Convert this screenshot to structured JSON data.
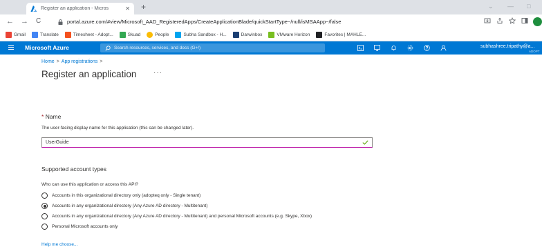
{
  "browser": {
    "tab_title": "Register an application - Micros",
    "tab_close": "✕",
    "new_tab": "+",
    "url": "portal.azure.com/#view/Microsoft_AAD_RegisteredApps/CreateApplicationBlade/quickStartType~/null/isMSAApp~/false",
    "nav": {
      "back": "←",
      "forward": "→",
      "reload": "C"
    },
    "window_controls": {
      "chevron": "⌄",
      "minimize": "—",
      "restore": "□"
    }
  },
  "bookmarks": [
    {
      "label": "Gmail",
      "color": "#ea4335"
    },
    {
      "label": "Translate",
      "color": "#4285f4"
    },
    {
      "label": "Timesheet - Adopt...",
      "color": "#f4511e"
    },
    {
      "label": "Skuad",
      "color": "#34a853"
    },
    {
      "label": "People",
      "color": "#fbbc04"
    },
    {
      "label": "Subha Sandbox - H...",
      "color": "#00a4ef"
    },
    {
      "label": "Darwinbox",
      "color": "#1a3e72"
    },
    {
      "label": "VMware Horizon",
      "color": "#78be20"
    },
    {
      "label": "Favorites | MAHLE...",
      "color": "#202124"
    }
  ],
  "azure": {
    "brand": "Microsoft Azure",
    "search_placeholder": "Search resources, services, and docs (G+/)",
    "user_email": "subhashree.tripathy@a...",
    "user_tenant": "ADOPT",
    "accent": "#0078d4"
  },
  "breadcrumb": [
    "Home",
    "App registrations"
  ],
  "breadcrumb_sep": ">",
  "page": {
    "title": "Register an application",
    "more": "···"
  },
  "name_section": {
    "required_mark": "*",
    "label": "Name",
    "description": "The user-facing display name for this application (this can be changed later).",
    "value": "UserGuide"
  },
  "account_types": {
    "heading": "Supported account types",
    "question": "Who can use this application or access this API?",
    "options": [
      {
        "label": "Accounts in this organizational directory only (adopteq only - Single tenant)",
        "selected": false
      },
      {
        "label": "Accounts in any organizational directory (Any Azure AD directory - Multitenant)",
        "selected": true
      },
      {
        "label": "Accounts in any organizational directory (Any Azure AD directory - Multitenant) and personal Microsoft accounts (e.g. Skype, Xbox)",
        "selected": false
      },
      {
        "label": "Personal Microsoft accounts only",
        "selected": false
      }
    ],
    "help_link": "Help me choose..."
  }
}
